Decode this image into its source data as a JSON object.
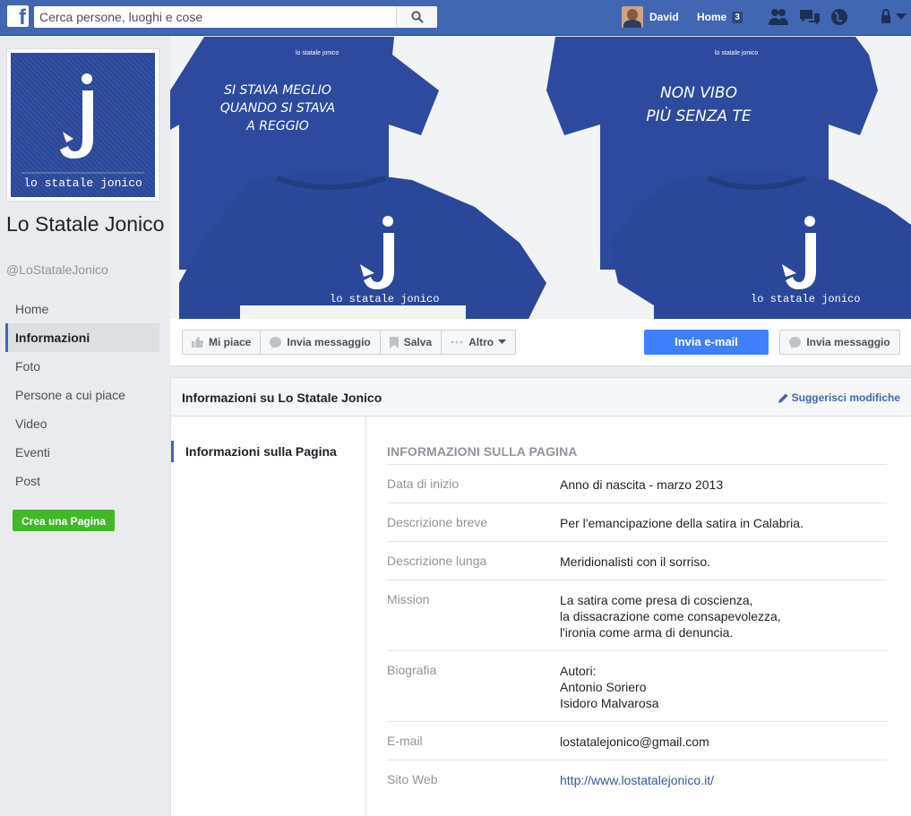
{
  "topbar": {
    "search_placeholder": "Cerca persone, luoghi e cose",
    "user_name": "David",
    "home_label": "Home",
    "home_count": "3"
  },
  "page": {
    "name": "Lo Statale Jonico",
    "handle": "@LoStataleJonico",
    "logo_caption": "lo statale jonico"
  },
  "nav": {
    "items": [
      {
        "label": "Home"
      },
      {
        "label": "Informazioni"
      },
      {
        "label": "Foto"
      },
      {
        "label": "Persone a cui piace"
      },
      {
        "label": "Video"
      },
      {
        "label": "Eventi"
      },
      {
        "label": "Post"
      }
    ],
    "create_page": "Crea una Pagina"
  },
  "cover": {
    "shirt1_lines": [
      "SI STAVA MEGLIO",
      "QUANDO SI STAVA",
      "A REGGIO"
    ],
    "shirt2_lines": [
      "NON VIBO",
      "PIÙ SENZA TE"
    ],
    "brand": "lo statale jonico",
    "tag": "lo statale jonico"
  },
  "actions": {
    "like": "Mi piace",
    "message": "Invia messaggio",
    "save": "Salva",
    "more": "Altro",
    "email": "Invia e-mail",
    "message2": "Invia messaggio"
  },
  "about": {
    "title": "Informazioni su Lo Statale Jonico",
    "suggest": "Suggerisci modifiche",
    "side_item": "Informazioni sulla Pagina",
    "section_title": "INFORMAZIONI SULLA PAGINA",
    "rows": [
      {
        "label": "Data di inizio",
        "value": [
          "Anno di nascita - marzo 2013"
        ]
      },
      {
        "label": "Descrizione breve",
        "value": [
          "Per l'emancipazione della satira in Calabria."
        ]
      },
      {
        "label": "Descrizione lunga",
        "value": [
          "Meridionalisti con il sorriso."
        ]
      },
      {
        "label": "Mission",
        "value": [
          "La satira come presa di coscienza,",
          "la dissacrazione come consapevolezza,",
          "l'ironia come arma di denuncia."
        ]
      },
      {
        "label": "Biografia",
        "value": [
          "Autori:",
          "Antonio Soriero",
          "Isidoro Malvarosa"
        ]
      },
      {
        "label": "E-mail",
        "value": [
          "lostatalejonico@gmail.com"
        ]
      },
      {
        "label": "Sito Web",
        "value": [
          "http://www.lostatalejonico.it/"
        ]
      }
    ]
  },
  "colors": {
    "fb_blue": "#4267b2",
    "shirt_blue": "#2d4a9e",
    "link": "#365899",
    "green": "#42b72a",
    "email_btn": "#4080ff"
  }
}
